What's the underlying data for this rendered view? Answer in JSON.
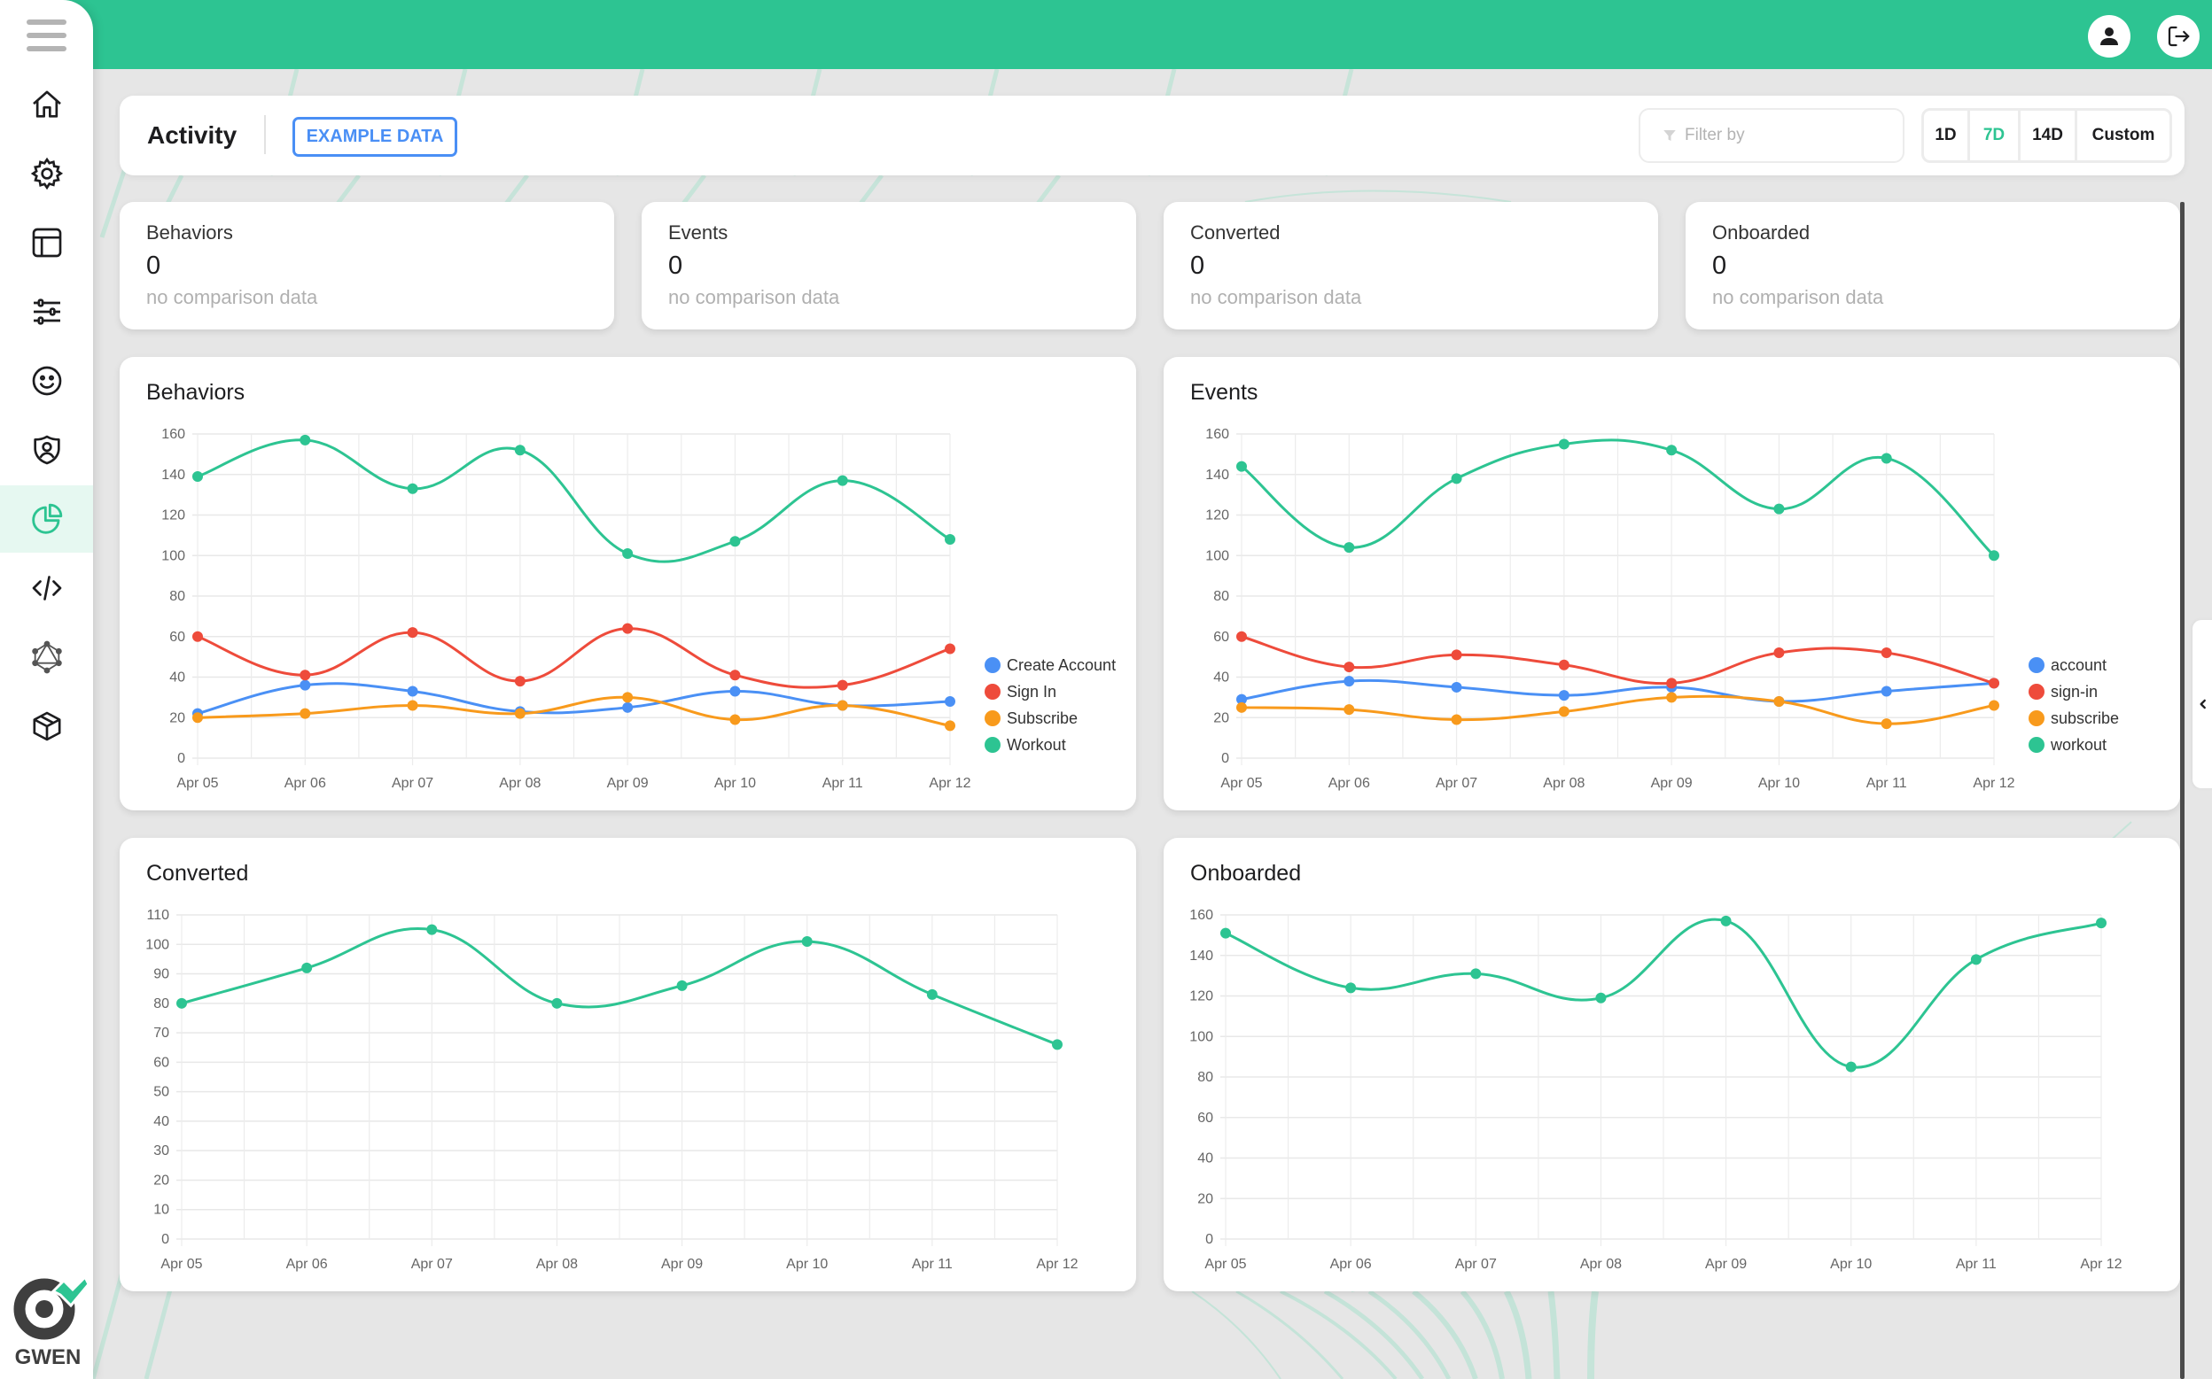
{
  "topbar": {
    "profile_icon": "user-icon",
    "logout_icon": "logout-icon",
    "brand_color": "#2dc492"
  },
  "sidebar": {
    "menu_icon": "hamburger-icon",
    "items": [
      {
        "name": "home",
        "icon": "home-icon",
        "active": false
      },
      {
        "name": "settings",
        "icon": "gear-icon",
        "active": false
      },
      {
        "name": "layout",
        "icon": "layout-icon",
        "active": false
      },
      {
        "name": "filters",
        "icon": "sliders-icon",
        "active": false
      },
      {
        "name": "users",
        "icon": "smiley-icon",
        "active": false
      },
      {
        "name": "security",
        "icon": "shield-user-icon",
        "active": false
      },
      {
        "name": "activity",
        "icon": "pie-chart-icon",
        "active": true
      },
      {
        "name": "code",
        "icon": "code-icon",
        "active": false
      },
      {
        "name": "graphql",
        "icon": "graphql-icon",
        "active": false
      },
      {
        "name": "packages",
        "icon": "box-icon",
        "active": false
      }
    ],
    "logo_text": "GWEN"
  },
  "header": {
    "title": "Activity",
    "example_button": "EXAMPLE DATA",
    "filter_placeholder": "Filter by",
    "filter_value": "",
    "ranges": [
      {
        "label": "1D",
        "active": false
      },
      {
        "label": "7D",
        "active": true
      },
      {
        "label": "14D",
        "active": false
      },
      {
        "label": "Custom",
        "active": false
      }
    ]
  },
  "stats": [
    {
      "label": "Behaviors",
      "value": "0",
      "sub": "no comparison data"
    },
    {
      "label": "Events",
      "value": "0",
      "sub": "no comparison data"
    },
    {
      "label": "Converted",
      "value": "0",
      "sub": "no comparison data"
    },
    {
      "label": "Onboarded",
      "value": "0",
      "sub": "no comparison data"
    }
  ],
  "colors": {
    "blue": "#4a90f5",
    "red": "#ee4b3b",
    "orange": "#f89a1c",
    "green": "#2dc492",
    "accent_blue": "#4a8ff5"
  },
  "chart_data": [
    {
      "type": "line",
      "title": "Behaviors",
      "categories": [
        "Apr 05",
        "Apr 06",
        "Apr 07",
        "Apr 08",
        "Apr 09",
        "Apr 10",
        "Apr 11",
        "Apr 12"
      ],
      "ylim": [
        0,
        160
      ],
      "yticks": [
        0,
        20,
        40,
        60,
        80,
        100,
        120,
        140,
        160
      ],
      "grid": true,
      "legend": "right",
      "series": [
        {
          "name": "Create Account",
          "color": "#4a90f5",
          "values": [
            22,
            36,
            33,
            23,
            25,
            33,
            26,
            28
          ]
        },
        {
          "name": "Sign In",
          "color": "#ee4b3b",
          "values": [
            60,
            41,
            62,
            38,
            64,
            41,
            36,
            54
          ]
        },
        {
          "name": "Subscribe",
          "color": "#f89a1c",
          "values": [
            20,
            22,
            26,
            22,
            30,
            19,
            26,
            16
          ]
        },
        {
          "name": "Workout",
          "color": "#2dc492",
          "values": [
            139,
            157,
            133,
            152,
            101,
            107,
            137,
            108
          ]
        }
      ],
      "xlabel": "",
      "ylabel": ""
    },
    {
      "type": "line",
      "title": "Events",
      "categories": [
        "Apr 05",
        "Apr 06",
        "Apr 07",
        "Apr 08",
        "Apr 09",
        "Apr 10",
        "Apr 11",
        "Apr 12"
      ],
      "ylim": [
        0,
        160
      ],
      "yticks": [
        0,
        20,
        40,
        60,
        80,
        100,
        120,
        140,
        160
      ],
      "grid": true,
      "legend": "right",
      "series": [
        {
          "name": "account",
          "color": "#4a90f5",
          "values": [
            29,
            38,
            35,
            31,
            35,
            28,
            33,
            37
          ]
        },
        {
          "name": "sign-in",
          "color": "#ee4b3b",
          "values": [
            60,
            45,
            51,
            46,
            37,
            52,
            52,
            37
          ]
        },
        {
          "name": "subscribe",
          "color": "#f89a1c",
          "values": [
            25,
            24,
            19,
            23,
            30,
            28,
            17,
            26
          ]
        },
        {
          "name": "workout",
          "color": "#2dc492",
          "values": [
            144,
            104,
            138,
            155,
            152,
            123,
            148,
            100
          ]
        }
      ],
      "xlabel": "",
      "ylabel": ""
    },
    {
      "type": "line",
      "title": "Converted",
      "categories": [
        "Apr 05",
        "Apr 06",
        "Apr 07",
        "Apr 08",
        "Apr 09",
        "Apr 10",
        "Apr 11",
        "Apr 12"
      ],
      "ylim": [
        0,
        110
      ],
      "yticks": [
        0,
        10,
        20,
        30,
        40,
        50,
        60,
        70,
        80,
        90,
        100,
        110
      ],
      "grid": true,
      "legend": "none",
      "series": [
        {
          "name": "Converted",
          "color": "#2dc492",
          "values": [
            80,
            92,
            105,
            80,
            86,
            101,
            83,
            66
          ]
        }
      ],
      "xlabel": "",
      "ylabel": ""
    },
    {
      "type": "line",
      "title": "Onboarded",
      "categories": [
        "Apr 05",
        "Apr 06",
        "Apr 07",
        "Apr 08",
        "Apr 09",
        "Apr 10",
        "Apr 11",
        "Apr 12"
      ],
      "ylim": [
        0,
        160
      ],
      "yticks": [
        0,
        20,
        40,
        60,
        80,
        100,
        120,
        140,
        160
      ],
      "grid": true,
      "legend": "none",
      "series": [
        {
          "name": "Onboarded",
          "color": "#2dc492",
          "values": [
            151,
            124,
            131,
            119,
            157,
            85,
            138,
            156
          ]
        }
      ],
      "xlabel": "",
      "ylabel": ""
    }
  ]
}
